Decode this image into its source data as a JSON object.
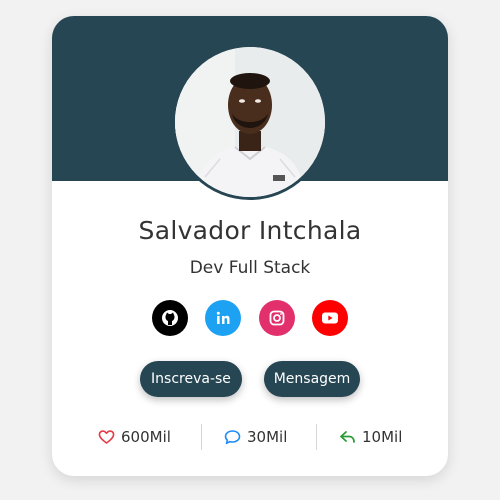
{
  "colors": {
    "banner": "#264653",
    "button": "#264653",
    "github": "#000000",
    "linkedin": "#1da1f2",
    "instagram": "#e1306c",
    "youtube": "#ff0000",
    "heart": "#e63946",
    "comment": "#1d8cf8",
    "share": "#2a9d3a"
  },
  "profile": {
    "name": "Salvador Intchala",
    "role": "Dev Full Stack",
    "avatar_alt": "profile-photo"
  },
  "socials": [
    {
      "icon": "github-icon"
    },
    {
      "icon": "linkedin-icon"
    },
    {
      "icon": "instagram-icon"
    },
    {
      "icon": "youtube-icon"
    }
  ],
  "buttons": {
    "subscribe": "Inscreva-se",
    "message": "Mensagem"
  },
  "stats": {
    "likes": "600Mil",
    "comments": "30Mil",
    "shares": "10Mil"
  }
}
